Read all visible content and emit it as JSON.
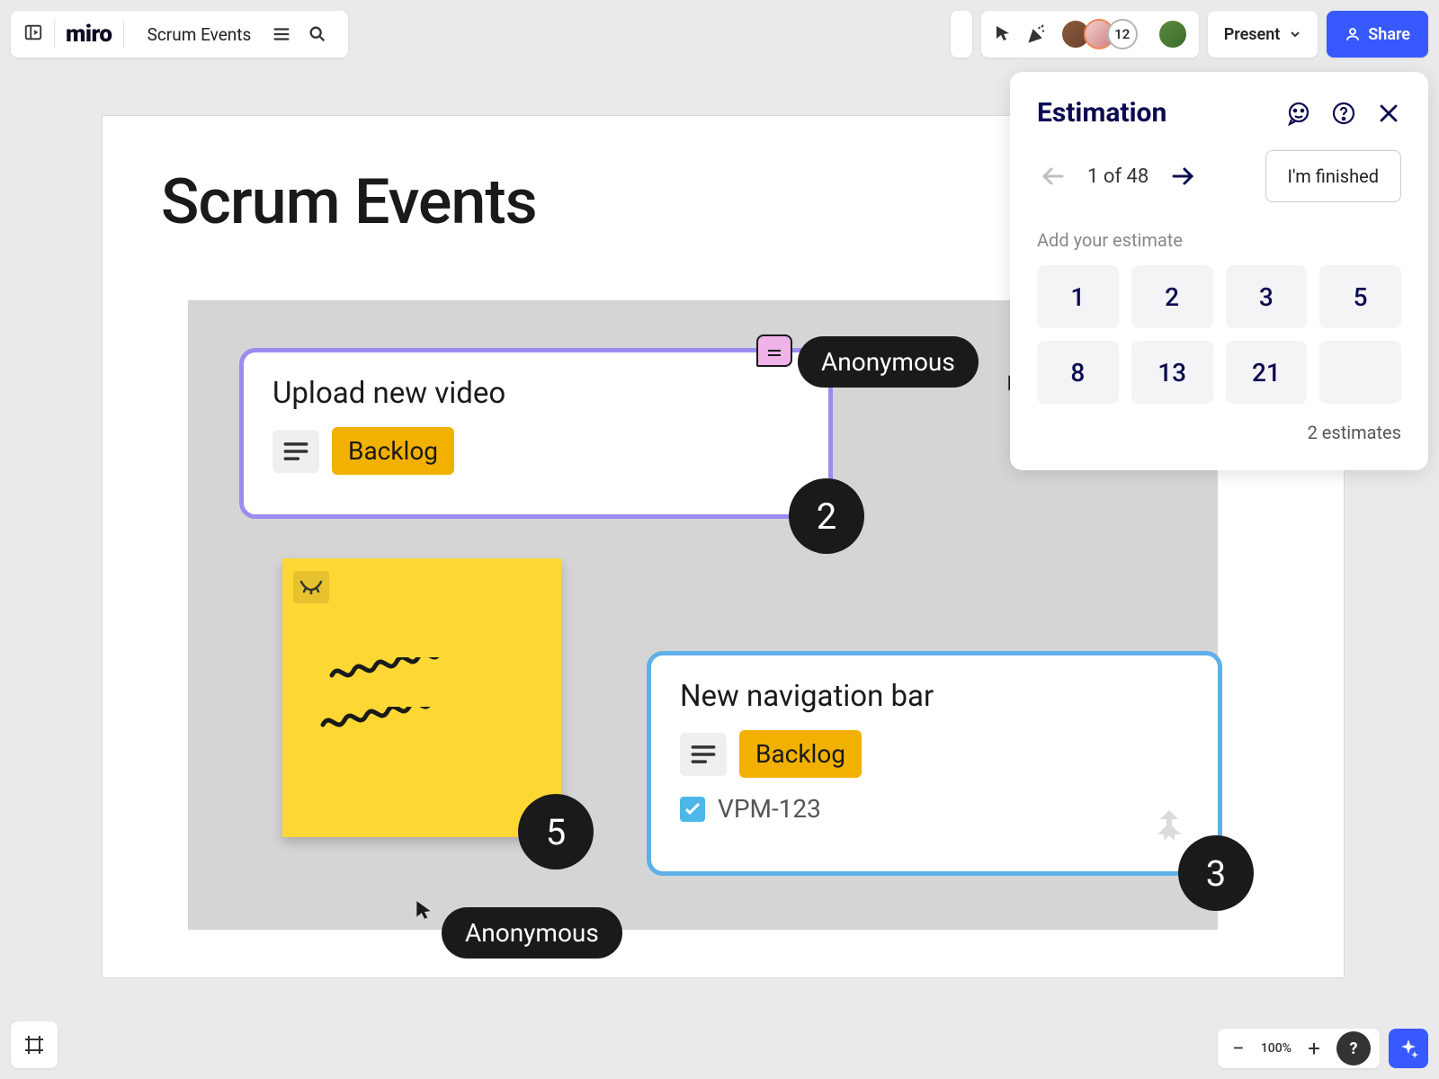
{
  "header": {
    "logo": "miro",
    "board_name": "Scrum Events",
    "avatar_extra_count": "12",
    "present_label": "Present",
    "share_label": "Share"
  },
  "frame": {
    "title": "Scrum Events"
  },
  "card1": {
    "title": "Upload new video",
    "status": "Backlog",
    "vote": "2"
  },
  "sticky": {
    "vote": "5"
  },
  "card2": {
    "title": "New navigation bar",
    "status": "Backlog",
    "ticket": "VPM-123",
    "vote": "3"
  },
  "cursors": {
    "anon1": "Anonymous",
    "anon2": "Anonymous"
  },
  "panel": {
    "title": "Estimation",
    "progress": "1 of 48",
    "finished_label": "I'm finished",
    "add_label": "Add your estimate",
    "options": [
      "1",
      "2",
      "3",
      "5",
      "8",
      "13",
      "21",
      ""
    ],
    "count_text": "2 estimates"
  },
  "bottom": {
    "zoom": "100%"
  }
}
